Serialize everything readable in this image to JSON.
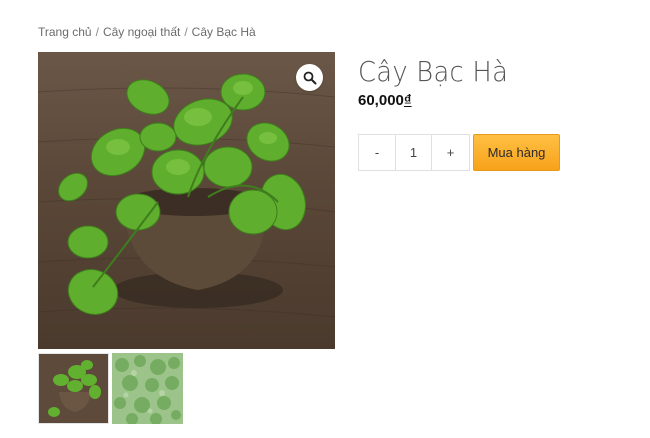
{
  "breadcrumb": {
    "items": [
      "Trang chủ",
      "Cây ngoại thất",
      "Cây Bạc Hà"
    ],
    "separator": "/"
  },
  "product": {
    "title": "Cây Bạc Hà",
    "price": "60,000",
    "currency": "₫"
  },
  "quantity": {
    "minus_label": "-",
    "value": "1",
    "plus_label": "+"
  },
  "buy_button": {
    "label": "Mua hàng",
    "color": "#f9ab25"
  },
  "gallery": {
    "zoom_icon": "magnifier-icon",
    "thumbnails": [
      "mint-pot-thumbnail",
      "mint-garden-thumbnail"
    ]
  }
}
